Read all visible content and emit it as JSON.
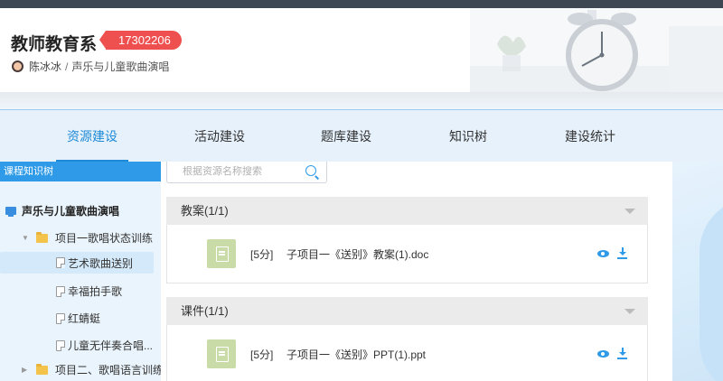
{
  "header": {
    "department": "教师教育系",
    "code": "17302206",
    "teacher": "陈冰冰",
    "separator": "/",
    "course": "声乐与儿童歌曲演唱"
  },
  "nav": {
    "tabs": [
      {
        "label": "资源建设",
        "active": true
      },
      {
        "label": "活动建设",
        "active": false
      },
      {
        "label": "题库建设",
        "active": false
      },
      {
        "label": "知识树",
        "active": false
      },
      {
        "label": "建设统计",
        "active": false
      }
    ]
  },
  "sidebar": {
    "title": "课程知识树",
    "root": "声乐与儿童歌曲演唱",
    "items": [
      {
        "label": "项目一歌唱状态训练",
        "type": "folder",
        "expanded": true
      },
      {
        "label": "艺术歌曲送别",
        "type": "file",
        "selected": true
      },
      {
        "label": "幸福拍手歌",
        "type": "file"
      },
      {
        "label": "红蜻蜓",
        "type": "file"
      },
      {
        "label": "儿童无伴奏合唱...",
        "type": "file"
      },
      {
        "label": "项目二、歌唱语言训练",
        "type": "folder",
        "expanded": false
      }
    ]
  },
  "search": {
    "placeholder": "根据资源名称搜索",
    "value": ""
  },
  "sections": [
    {
      "title": "教案(1/1)",
      "file": {
        "score": "[5分]",
        "name": "子项目一《送别》教案(1).doc"
      }
    },
    {
      "title": "课件(1/1)",
      "file": {
        "score": "[5分]",
        "name": "子项目一《送别》PPT(1).ppt"
      }
    }
  ],
  "colors": {
    "accent": "#1e8ad6",
    "badge": "#ee4f4f",
    "sidebar_title": "#2f9be8",
    "thumb": "#c9dba6"
  },
  "icons": {
    "avatar": "user-avatar-icon",
    "root": "monitor-icon",
    "folder": "folder-icon",
    "file": "file-icon",
    "search": "search-icon",
    "preview": "eye-icon",
    "download": "download-icon",
    "collapse": "caret-down-icon"
  }
}
